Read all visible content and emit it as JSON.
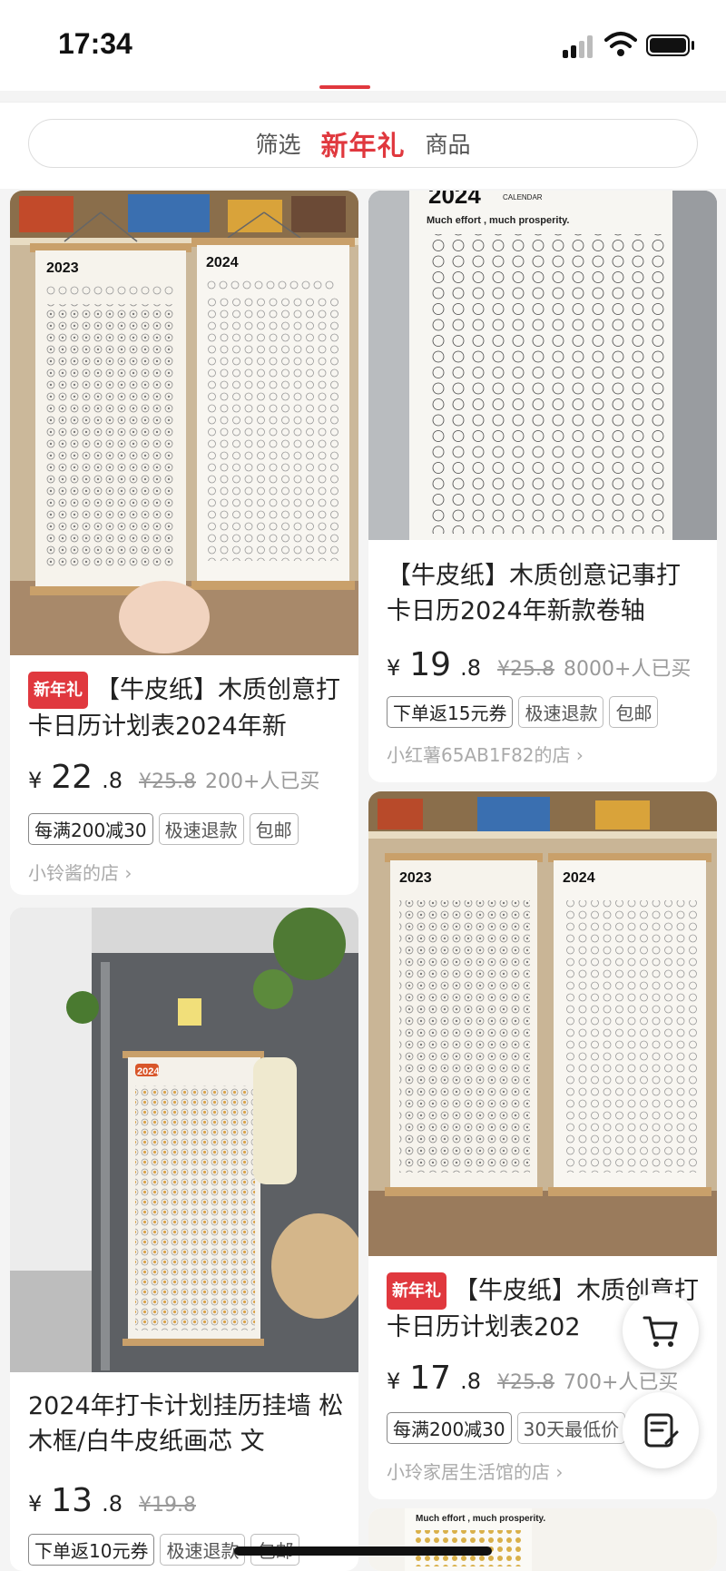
{
  "status_bar": {
    "time": "17:34"
  },
  "header": {
    "filter_label": "筛选",
    "new_year_label": "新年礼",
    "products_label": "商品"
  },
  "products": [
    {
      "badge": "新年礼",
      "title": "【牛皮纸】木质创意打卡日历计划表2024年新",
      "currency": "¥",
      "price_int": "22",
      "price_dec": ".8",
      "old_price": "¥25.8",
      "sold": "200+人已买",
      "tags": [
        "每满200减30",
        "极速退款",
        "包邮"
      ],
      "shop": "小铃酱的店 ›"
    },
    {
      "title": "【牛皮纸】木质创意记事打卡日历2024年新款卷轴",
      "currency": "¥",
      "price_int": "19",
      "price_dec": ".8",
      "old_price": "¥25.8",
      "sold": "8000+人已买",
      "tags": [
        "下单返15元券",
        "极速退款",
        "包邮"
      ],
      "shop": "小红薯65AB1F82的店 ›"
    },
    {
      "title": "2024年打卡计划挂历挂墙 松木框/白牛皮纸画芯 文",
      "currency": "¥",
      "price_int": "13",
      "price_dec": ".8",
      "old_price": "¥19.8",
      "tags": [
        "下单返10元券",
        "极速退款",
        "包邮"
      ]
    },
    {
      "badge": "新年礼",
      "title": "【牛皮纸】木质创意打卡日历计划表202",
      "currency": "¥",
      "price_int": "17",
      "price_dec": ".8",
      "old_price": "¥25.8",
      "sold": "700+人已买",
      "tags": [
        "每满200减30",
        "30天最低价"
      ],
      "shop": "小玲家居生活馆的店 ›"
    }
  ],
  "image_text": {
    "y2023": "2023",
    "y2024": "2024",
    "motto": "Much effort , much prosperity.",
    "calendar_word": "CALENDAR",
    "months": [
      "JAN",
      "FEB",
      "MAR",
      "APR",
      "MAY",
      "JUN",
      "JUL",
      "AUG",
      "SEP",
      "OCT",
      "NOV",
      "DEC"
    ]
  },
  "fab": {
    "cart_icon": "cart-icon",
    "notes_icon": "notes-icon"
  },
  "colors": {
    "accent": "#e0383e"
  }
}
